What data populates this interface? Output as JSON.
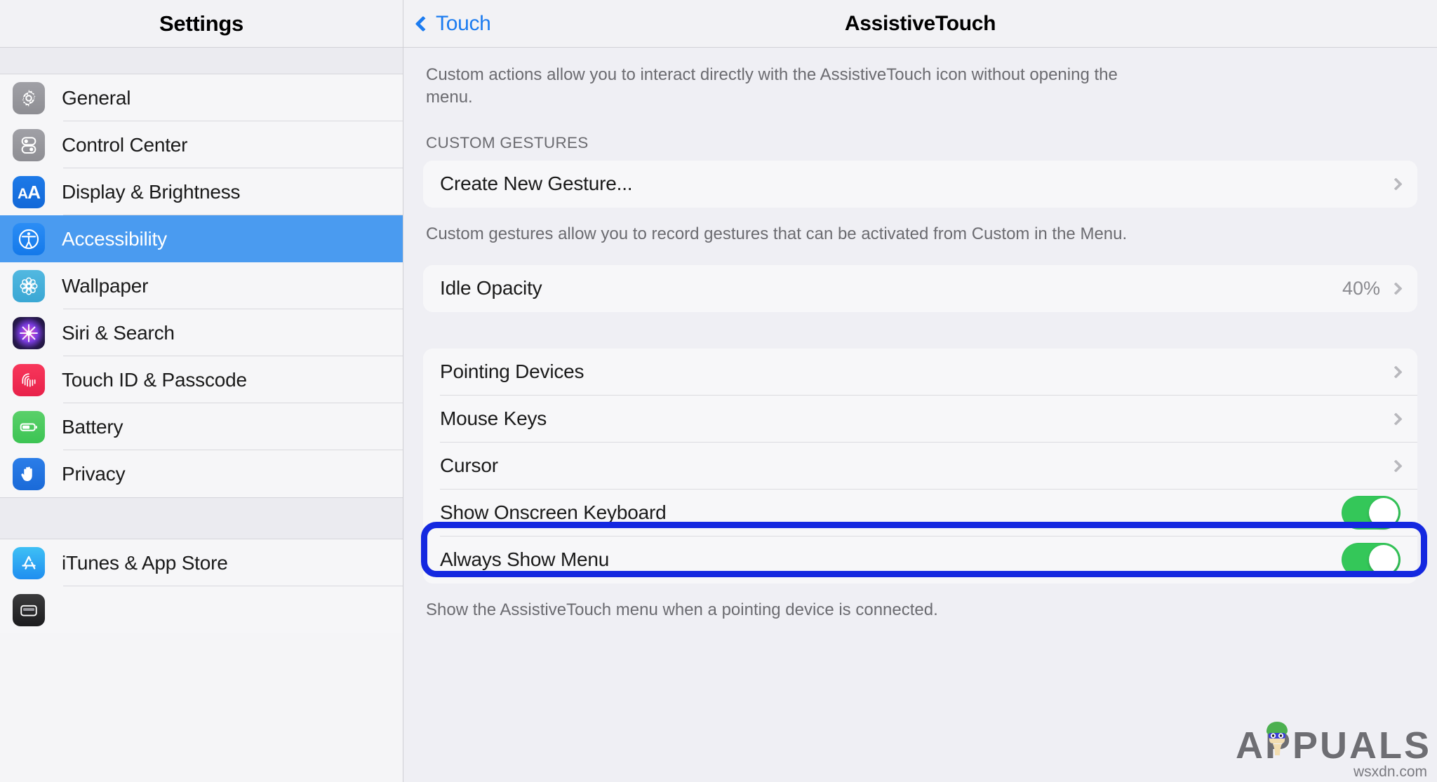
{
  "sidebar": {
    "title": "Settings",
    "items": [
      {
        "label": "General",
        "icon": "gear-icon",
        "icon_class": "ic-gear",
        "glyph": "⚙",
        "selected": false
      },
      {
        "label": "Control Center",
        "icon": "sliders-icon",
        "icon_class": "ic-control",
        "glyph": "",
        "selected": false
      },
      {
        "label": "Display & Brightness",
        "icon": "aa-text-icon",
        "icon_class": "ic-display",
        "glyph": "",
        "selected": false
      },
      {
        "label": "Accessibility",
        "icon": "accessibility-icon",
        "icon_class": "ic-access",
        "glyph": "",
        "selected": true
      },
      {
        "label": "Wallpaper",
        "icon": "flower-icon",
        "icon_class": "ic-wallpaper",
        "glyph": "✿",
        "selected": false
      },
      {
        "label": "Siri & Search",
        "icon": "siri-orb-icon",
        "icon_class": "ic-siri",
        "glyph": "",
        "selected": false
      },
      {
        "label": "Touch ID & Passcode",
        "icon": "fingerprint-icon",
        "icon_class": "ic-touchid",
        "glyph": "",
        "selected": false
      },
      {
        "label": "Battery",
        "icon": "battery-icon",
        "icon_class": "ic-battery",
        "glyph": "",
        "selected": false
      },
      {
        "label": "Privacy",
        "icon": "hand-icon",
        "icon_class": "ic-privacy",
        "glyph": "✋",
        "selected": false
      }
    ],
    "items_lower": [
      {
        "label": "iTunes & App Store",
        "icon": "app-store-icon",
        "icon_class": "ic-appstore",
        "glyph": "A",
        "selected": false
      },
      {
        "label": "",
        "icon": "wallet-icon",
        "icon_class": "ic-wallet",
        "glyph": "",
        "selected": false
      }
    ]
  },
  "detail": {
    "back_label": "Touch",
    "title": "AssistiveTouch",
    "custom_actions_desc": "Custom actions allow you to interact directly with the AssistiveTouch icon without opening the menu.",
    "gestures_group_header": "CUSTOM GESTURES",
    "create_gesture_label": "Create New Gesture...",
    "custom_gestures_desc": "Custom gestures allow you to record gestures that can be activated from Custom in the Menu.",
    "idle_opacity_label": "Idle Opacity",
    "idle_opacity_value": "40%",
    "pointing_devices_label": "Pointing Devices",
    "mouse_keys_label": "Mouse Keys",
    "cursor_label": "Cursor",
    "show_onscreen_keyboard_label": "Show Onscreen Keyboard",
    "show_onscreen_keyboard_state": "on",
    "always_show_menu_label": "Always Show Menu",
    "always_show_menu_state": "on",
    "always_show_menu_desc": "Show the AssistiveTouch menu when a pointing device is connected."
  },
  "annotation": {
    "target": "always-show-menu-row",
    "color": "#1428e0"
  },
  "watermark": {
    "brand": "APPUALS",
    "site": "wsxdn.com"
  },
  "colors": {
    "selection_blue": "#4a9bf0",
    "link_blue": "#1c7cf0",
    "toggle_green": "#34C759",
    "annotation_blue": "#1428e0",
    "panel_bg": "#efeff4",
    "card_bg": "#f7f7f9"
  }
}
